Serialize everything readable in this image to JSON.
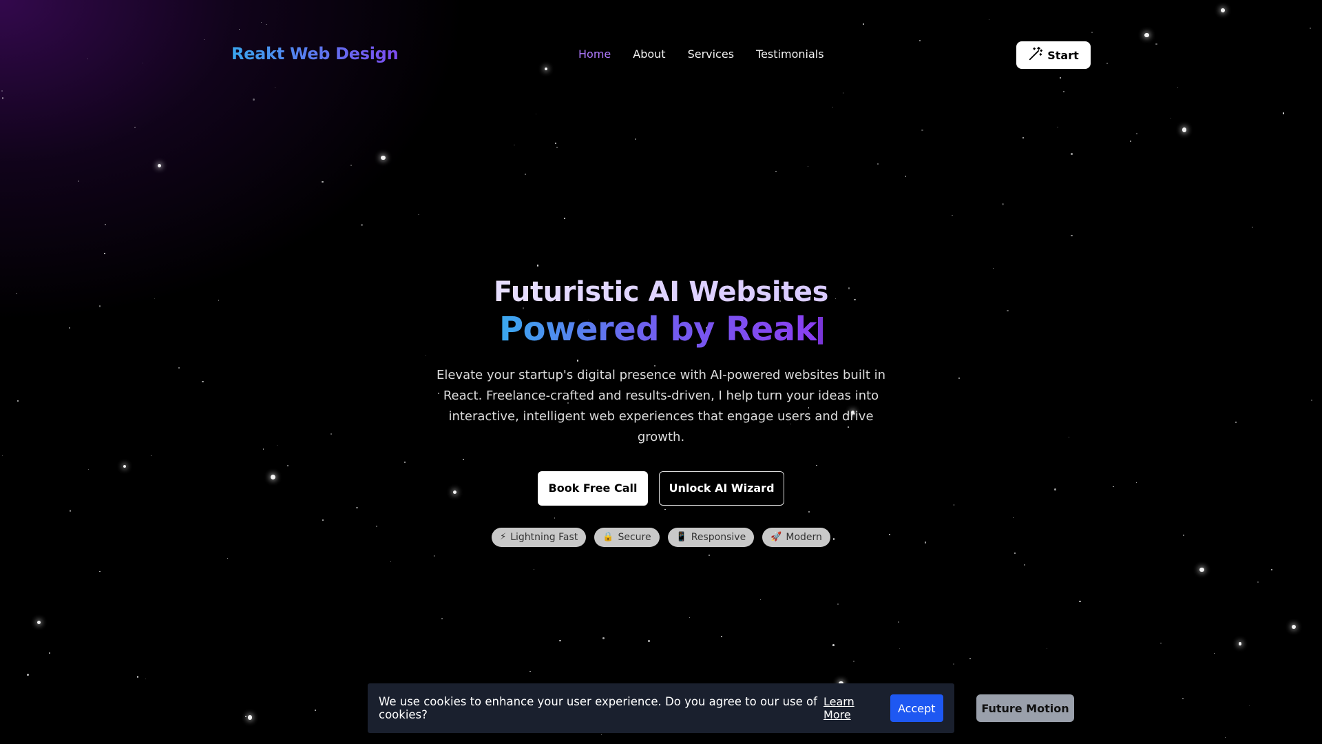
{
  "brand": {
    "name": "Reakt Web Design"
  },
  "nav": {
    "links": [
      {
        "label": "Home",
        "active": true
      },
      {
        "label": "About",
        "active": false
      },
      {
        "label": "Services",
        "active": false
      },
      {
        "label": "Testimonials",
        "active": false
      }
    ],
    "start_label": "Start",
    "start_icon": "magic-wand-icon"
  },
  "hero": {
    "title_line1": "Futuristic AI Websites",
    "title_line2": "Powered by Reak",
    "subtitle": "Elevate your startup's digital presence with AI-powered websites built in React. Freelance-crafted and results-driven, I help turn your ideas into interactive, intelligent web experiences that engage users and drive growth.",
    "primary_cta": "Book Free Call",
    "secondary_cta": "Unlock AI Wizard",
    "features": [
      {
        "icon": "⚡",
        "icon_name": "lightning-icon",
        "label": "Lightning Fast"
      },
      {
        "icon": "🔒",
        "icon_name": "lock-icon",
        "label": "Secure"
      },
      {
        "icon": "📱",
        "icon_name": "phone-icon",
        "label": "Responsive"
      },
      {
        "icon": "🚀",
        "icon_name": "rocket-icon",
        "label": "Modern"
      }
    ]
  },
  "cookie_banner": {
    "text": "We use cookies to enhance your user experience. Do you agree to our use of cookies?",
    "link_label": "Learn More",
    "accept_label": "Accept"
  },
  "future_motion": {
    "label": "Future Motion"
  },
  "colors": {
    "background": "#000000",
    "nav_active": "#b07aff",
    "accept_button": "#1e58f2",
    "cookie_bg": "#1a202e",
    "pill_bg": "#c9c9c9",
    "future_button": "#9aa0ab"
  }
}
